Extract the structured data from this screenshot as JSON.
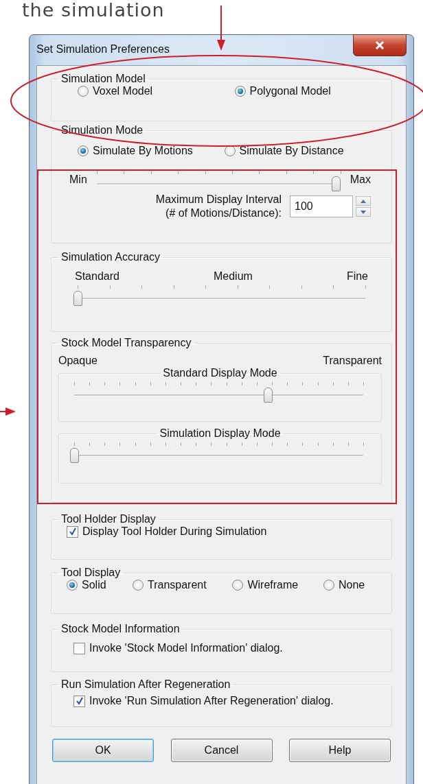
{
  "caption": "the simulation",
  "window": {
    "title": "Set Simulation Preferences"
  },
  "simulation_model": {
    "label": "Simulation Model",
    "options": [
      {
        "label": "Voxel Model",
        "selected": false
      },
      {
        "label": "Polygonal Model",
        "selected": true
      }
    ]
  },
  "simulation_mode": {
    "label": "Simulation Mode",
    "options": [
      {
        "label": "Simulate By Motions",
        "selected": true
      },
      {
        "label": "Simulate By Distance",
        "selected": false
      }
    ],
    "slider": {
      "min_label": "Min",
      "max_label": "Max",
      "level": 0.98
    },
    "interval": {
      "label": "Maximum Display Interval\n(# of Motions/Distance):",
      "value": "100"
    }
  },
  "simulation_accuracy": {
    "label": "Simulation Accuracy",
    "marks": [
      "Standard",
      "Medium",
      "Fine"
    ],
    "level": 0
  },
  "stock_model_transparency": {
    "label": "Stock Model Transparency",
    "left_label": "Opaque",
    "right_label": "Transparent",
    "modes": [
      {
        "label": "Standard Display Mode",
        "level": 0.67
      },
      {
        "label": "Simulation Display Mode",
        "level": 0
      }
    ]
  },
  "tool_holder_display": {
    "label": "Tool Holder Display",
    "checkbox": {
      "label": "Display Tool Holder During Simulation",
      "checked": true
    }
  },
  "tool_display": {
    "label": "Tool Display",
    "options": [
      {
        "label": "Solid",
        "selected": true
      },
      {
        "label": "Transparent",
        "selected": false
      },
      {
        "label": "Wireframe",
        "selected": false
      },
      {
        "label": "None",
        "selected": false
      }
    ]
  },
  "stock_model_information": {
    "label": "Stock Model Information",
    "checkbox": {
      "label": "Invoke 'Stock Model Information' dialog.",
      "checked": false
    }
  },
  "run_simulation": {
    "label": "Run Simulation After Regeneration",
    "checkbox": {
      "label": "Invoke 'Run Simulation After Regeneration' dialog.",
      "checked": true
    }
  },
  "buttons": [
    {
      "label": "OK",
      "default": true
    },
    {
      "label": "Cancel",
      "default": false
    },
    {
      "label": "Help",
      "default": false
    }
  ]
}
